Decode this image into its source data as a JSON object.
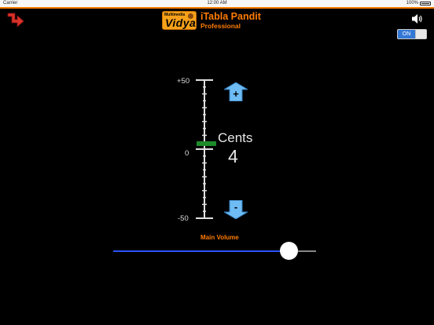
{
  "status_bar": {
    "carrier": "Carrier",
    "time": "12:00 AM",
    "battery": "100%"
  },
  "header": {
    "logo_small": "Multimedia",
    "logo_big": "Vidya",
    "title": "iTabla Pandit",
    "subtitle": "Professional"
  },
  "icons": {
    "back": "back-arrow-icon",
    "speaker": "speaker-icon",
    "up": "arrow-up-icon",
    "down": "arrow-down-icon"
  },
  "toggle": {
    "label": "ON",
    "state": true
  },
  "tuner": {
    "max_label": "+50",
    "zero_label": "0",
    "min_label": "-50",
    "up_symbol": "+",
    "down_symbol": "-",
    "cents_label": "Cents",
    "cents_value": "4",
    "range": [
      -50,
      50
    ],
    "indicator_value": 4
  },
  "volume": {
    "label": "Main Volume",
    "value": 0.87
  },
  "colors": {
    "accent": "#ff7b00",
    "slider_fill": "#2a55ff",
    "indicator": "#1e8a2a",
    "arrow": "#6fbcf5",
    "toggle": "#3478d6"
  }
}
